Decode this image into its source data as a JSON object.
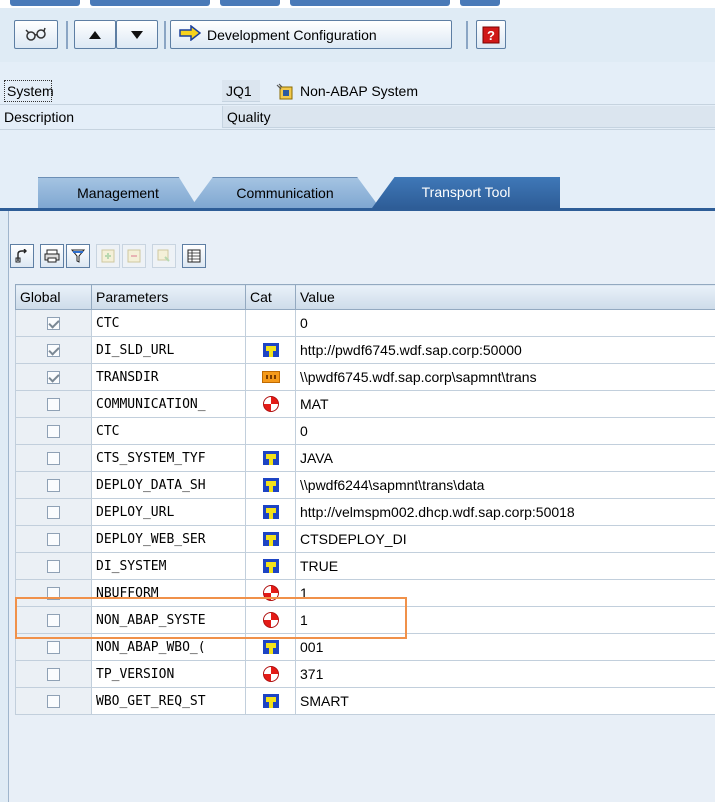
{
  "toolbar": {
    "dev_config_label": "Development Configuration",
    "icons": [
      "glasses-icon",
      "arrow-up-icon",
      "arrow-down-icon",
      "arrow-right-icon",
      "help-icon"
    ]
  },
  "header": {
    "system_label": "System",
    "system_value": "JQ1",
    "system_type": "Non-ABAP System",
    "description_label": "Description",
    "description_value": "Quality"
  },
  "tabs": [
    {
      "label": "Management"
    },
    {
      "label": "Communication"
    },
    {
      "label": "Transport Tool"
    }
  ],
  "grid_toolbar": {
    "icons": [
      "details-icon",
      "print-icon",
      "filter-icon",
      "add-row-icon",
      "delete-row-icon",
      "copy-row-icon",
      "layout-icon"
    ]
  },
  "table": {
    "columns": [
      "Global",
      "Parameters",
      "Cat",
      "Value"
    ],
    "rows": [
      {
        "global": true,
        "param": "CTC",
        "cat": "",
        "value": "0"
      },
      {
        "global": true,
        "param": "DI_SLD_URL",
        "cat": "java-icon",
        "value": "http://pwdf6745.wdf.sap.corp:50000"
      },
      {
        "global": true,
        "param": "TRANSDIR",
        "cat": "transport-icon",
        "value": "\\\\pwdf6745.wdf.sap.corp\\sapmnt\\trans"
      },
      {
        "global": false,
        "param": "COMMUNICATION_",
        "cat": "ctc-icon",
        "value": "MAT"
      },
      {
        "global": false,
        "param": "CTC",
        "cat": "",
        "value": "0"
      },
      {
        "global": false,
        "param": "CTS_SYSTEM_TYF",
        "cat": "java-icon",
        "value": "JAVA"
      },
      {
        "global": false,
        "param": "DEPLOY_DATA_SH",
        "cat": "java-icon",
        "value": "\\\\pwdf6244\\sapmnt\\trans\\data"
      },
      {
        "global": false,
        "param": "DEPLOY_URL",
        "cat": "java-icon",
        "value": "http://velmspm002.dhcp.wdf.sap.corp:50018"
      },
      {
        "global": false,
        "param": "DEPLOY_WEB_SER",
        "cat": "java-icon",
        "value": "CTSDEPLOY_DI"
      },
      {
        "global": false,
        "param": "DI_SYSTEM",
        "cat": "java-icon",
        "value": "TRUE"
      },
      {
        "global": false,
        "param": "NBUFFORM",
        "cat": "ctc-icon",
        "value": "1"
      },
      {
        "global": false,
        "param": "NON_ABAP_SYSTE",
        "cat": "ctc-icon",
        "value": "1"
      },
      {
        "global": false,
        "param": "NON_ABAP_WBO_(",
        "cat": "java-icon",
        "value": "001"
      },
      {
        "global": false,
        "param": "TP_VERSION",
        "cat": "ctc-icon",
        "value": "371"
      },
      {
        "global": false,
        "param": "WBO_GET_REQ_ST",
        "cat": "java-icon",
        "value": "SMART"
      }
    ]
  },
  "colors": {
    "highlight": "#f0914a",
    "active_tab": "#2e5d97"
  }
}
